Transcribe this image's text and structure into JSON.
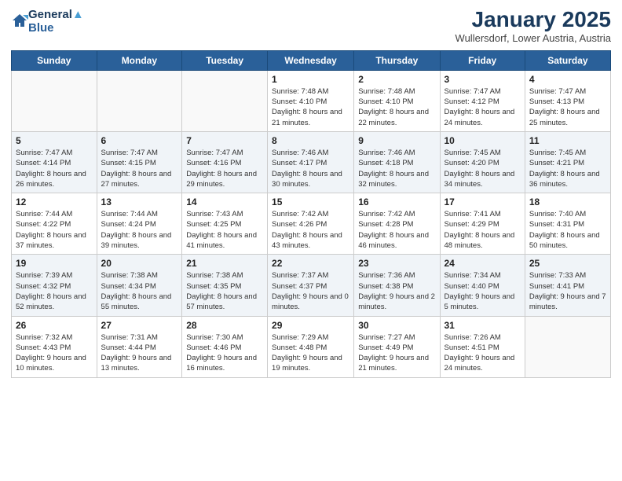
{
  "header": {
    "logo_line1": "General",
    "logo_line2": "Blue",
    "month": "January 2025",
    "location": "Wullersdorf, Lower Austria, Austria"
  },
  "weekdays": [
    "Sunday",
    "Monday",
    "Tuesday",
    "Wednesday",
    "Thursday",
    "Friday",
    "Saturday"
  ],
  "weeks": [
    [
      {
        "day": "",
        "info": ""
      },
      {
        "day": "",
        "info": ""
      },
      {
        "day": "",
        "info": ""
      },
      {
        "day": "1",
        "info": "Sunrise: 7:48 AM\nSunset: 4:10 PM\nDaylight: 8 hours and 21 minutes."
      },
      {
        "day": "2",
        "info": "Sunrise: 7:48 AM\nSunset: 4:10 PM\nDaylight: 8 hours and 22 minutes."
      },
      {
        "day": "3",
        "info": "Sunrise: 7:47 AM\nSunset: 4:12 PM\nDaylight: 8 hours and 24 minutes."
      },
      {
        "day": "4",
        "info": "Sunrise: 7:47 AM\nSunset: 4:13 PM\nDaylight: 8 hours and 25 minutes."
      }
    ],
    [
      {
        "day": "5",
        "info": "Sunrise: 7:47 AM\nSunset: 4:14 PM\nDaylight: 8 hours and 26 minutes."
      },
      {
        "day": "6",
        "info": "Sunrise: 7:47 AM\nSunset: 4:15 PM\nDaylight: 8 hours and 27 minutes."
      },
      {
        "day": "7",
        "info": "Sunrise: 7:47 AM\nSunset: 4:16 PM\nDaylight: 8 hours and 29 minutes."
      },
      {
        "day": "8",
        "info": "Sunrise: 7:46 AM\nSunset: 4:17 PM\nDaylight: 8 hours and 30 minutes."
      },
      {
        "day": "9",
        "info": "Sunrise: 7:46 AM\nSunset: 4:18 PM\nDaylight: 8 hours and 32 minutes."
      },
      {
        "day": "10",
        "info": "Sunrise: 7:45 AM\nSunset: 4:20 PM\nDaylight: 8 hours and 34 minutes."
      },
      {
        "day": "11",
        "info": "Sunrise: 7:45 AM\nSunset: 4:21 PM\nDaylight: 8 hours and 36 minutes."
      }
    ],
    [
      {
        "day": "12",
        "info": "Sunrise: 7:44 AM\nSunset: 4:22 PM\nDaylight: 8 hours and 37 minutes."
      },
      {
        "day": "13",
        "info": "Sunrise: 7:44 AM\nSunset: 4:24 PM\nDaylight: 8 hours and 39 minutes."
      },
      {
        "day": "14",
        "info": "Sunrise: 7:43 AM\nSunset: 4:25 PM\nDaylight: 8 hours and 41 minutes."
      },
      {
        "day": "15",
        "info": "Sunrise: 7:42 AM\nSunset: 4:26 PM\nDaylight: 8 hours and 43 minutes."
      },
      {
        "day": "16",
        "info": "Sunrise: 7:42 AM\nSunset: 4:28 PM\nDaylight: 8 hours and 46 minutes."
      },
      {
        "day": "17",
        "info": "Sunrise: 7:41 AM\nSunset: 4:29 PM\nDaylight: 8 hours and 48 minutes."
      },
      {
        "day": "18",
        "info": "Sunrise: 7:40 AM\nSunset: 4:31 PM\nDaylight: 8 hours and 50 minutes."
      }
    ],
    [
      {
        "day": "19",
        "info": "Sunrise: 7:39 AM\nSunset: 4:32 PM\nDaylight: 8 hours and 52 minutes."
      },
      {
        "day": "20",
        "info": "Sunrise: 7:38 AM\nSunset: 4:34 PM\nDaylight: 8 hours and 55 minutes."
      },
      {
        "day": "21",
        "info": "Sunrise: 7:38 AM\nSunset: 4:35 PM\nDaylight: 8 hours and 57 minutes."
      },
      {
        "day": "22",
        "info": "Sunrise: 7:37 AM\nSunset: 4:37 PM\nDaylight: 9 hours and 0 minutes."
      },
      {
        "day": "23",
        "info": "Sunrise: 7:36 AM\nSunset: 4:38 PM\nDaylight: 9 hours and 2 minutes."
      },
      {
        "day": "24",
        "info": "Sunrise: 7:34 AM\nSunset: 4:40 PM\nDaylight: 9 hours and 5 minutes."
      },
      {
        "day": "25",
        "info": "Sunrise: 7:33 AM\nSunset: 4:41 PM\nDaylight: 9 hours and 7 minutes."
      }
    ],
    [
      {
        "day": "26",
        "info": "Sunrise: 7:32 AM\nSunset: 4:43 PM\nDaylight: 9 hours and 10 minutes."
      },
      {
        "day": "27",
        "info": "Sunrise: 7:31 AM\nSunset: 4:44 PM\nDaylight: 9 hours and 13 minutes."
      },
      {
        "day": "28",
        "info": "Sunrise: 7:30 AM\nSunset: 4:46 PM\nDaylight: 9 hours and 16 minutes."
      },
      {
        "day": "29",
        "info": "Sunrise: 7:29 AM\nSunset: 4:48 PM\nDaylight: 9 hours and 19 minutes."
      },
      {
        "day": "30",
        "info": "Sunrise: 7:27 AM\nSunset: 4:49 PM\nDaylight: 9 hours and 21 minutes."
      },
      {
        "day": "31",
        "info": "Sunrise: 7:26 AM\nSunset: 4:51 PM\nDaylight: 9 hours and 24 minutes."
      },
      {
        "day": "",
        "info": ""
      }
    ]
  ]
}
